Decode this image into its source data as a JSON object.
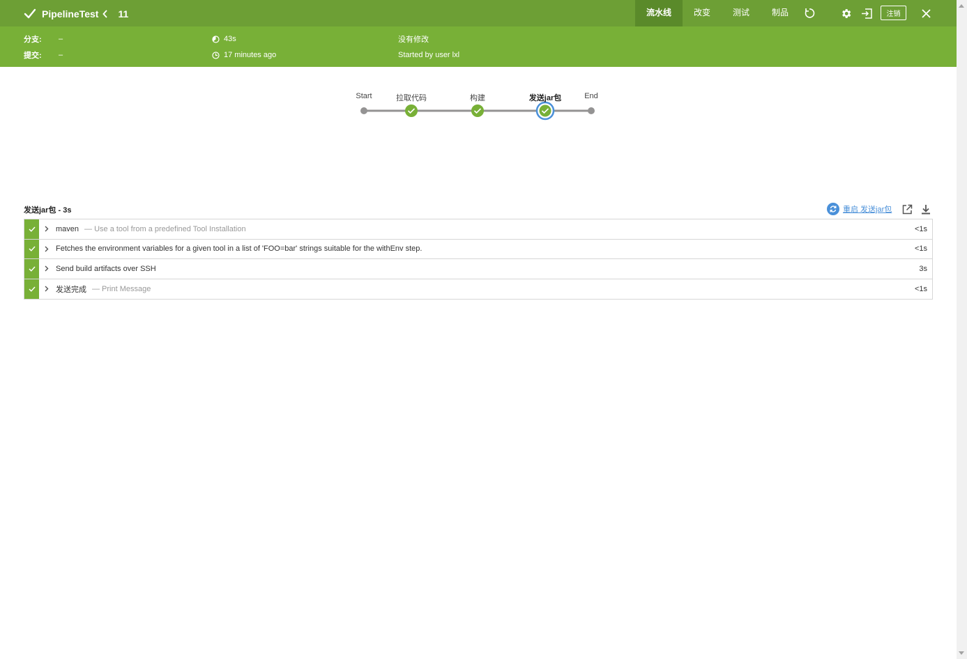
{
  "header": {
    "job_name": "PipelineTest",
    "build_number": "11",
    "tabs": [
      "流水线",
      "改变",
      "测试",
      "制品"
    ],
    "active_tab": "流水线",
    "logout_label": "注销",
    "accent_color": "#6d9f35",
    "icons": [
      "check-icon",
      "chevron-left-icon",
      "replay-icon",
      "gear-icon",
      "login-icon",
      "close-icon"
    ]
  },
  "info": {
    "branch_label": "分支:",
    "branch_value": "–",
    "commit_label": "提交:",
    "commit_value": "–",
    "duration": "43s",
    "time_ago": "17 minutes ago",
    "changes": "没有修改",
    "started_by": "Started by user lxl",
    "bar_color": "#78b037"
  },
  "pipeline": {
    "stages": [
      {
        "label": "Start",
        "status": "none"
      },
      {
        "label": "拉取代码",
        "status": "success"
      },
      {
        "label": "构建",
        "status": "success"
      },
      {
        "label": "发送jar包",
        "status": "success",
        "selected": true
      },
      {
        "label": "End",
        "status": "none"
      }
    ]
  },
  "detail": {
    "title": "发送jar包 - 3s",
    "restart_label": "重启 发送jar包",
    "icons": [
      "restart-icon",
      "open-external-icon",
      "download-icon"
    ],
    "steps": [
      {
        "name": "maven",
        "desc": "— Use a tool from a predefined Tool Installation",
        "duration": "<1s"
      },
      {
        "name": "Fetches the environment variables for a given tool in a list of 'FOO=bar' strings suitable for the withEnv step.",
        "desc": "",
        "duration": "<1s"
      },
      {
        "name": "Send build artifacts over SSH",
        "desc": "",
        "duration": "3s"
      },
      {
        "name": "发送完成",
        "desc": "— Print Message",
        "duration": "<1s"
      }
    ]
  }
}
